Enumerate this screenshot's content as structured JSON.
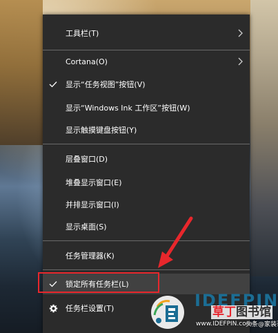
{
  "menu": {
    "items": [
      {
        "label": "工具栏(T)"
      },
      {
        "label": "Cortana(O)"
      },
      {
        "label": "显示“任务视图”按钮(V)"
      },
      {
        "label": "显示“Windows Ink 工作区”按钮(W)"
      },
      {
        "label": "显示触摸键盘按钮(Y)"
      },
      {
        "label": "层叠窗口(D)"
      },
      {
        "label": "堆叠显示窗口(E)"
      },
      {
        "label": "并排显示窗口(I)"
      },
      {
        "label": "显示桌面(S)"
      },
      {
        "label": "任务管理器(K)"
      },
      {
        "label": "锁定所有任务栏(L)"
      },
      {
        "label": "任务栏设置(T)"
      }
    ]
  },
  "icons": {
    "check": "check-icon",
    "gear": "gear-icon",
    "submenu": "chevron-right-icon"
  },
  "colors": {
    "menu_bg": "#2b2b2b",
    "highlight": "#414141",
    "text": "#ffffff",
    "separator": "#6a6a6a",
    "annotation_red": "#e8272c",
    "watermark_blue": "#1b6d94"
  },
  "watermark": {
    "title": "IDEFPIN",
    "sub_red": "草丁",
    "sub_dark": "图书馆",
    "url": "www.IDEFPIN.com",
    "handle": "头条@家装哥"
  }
}
